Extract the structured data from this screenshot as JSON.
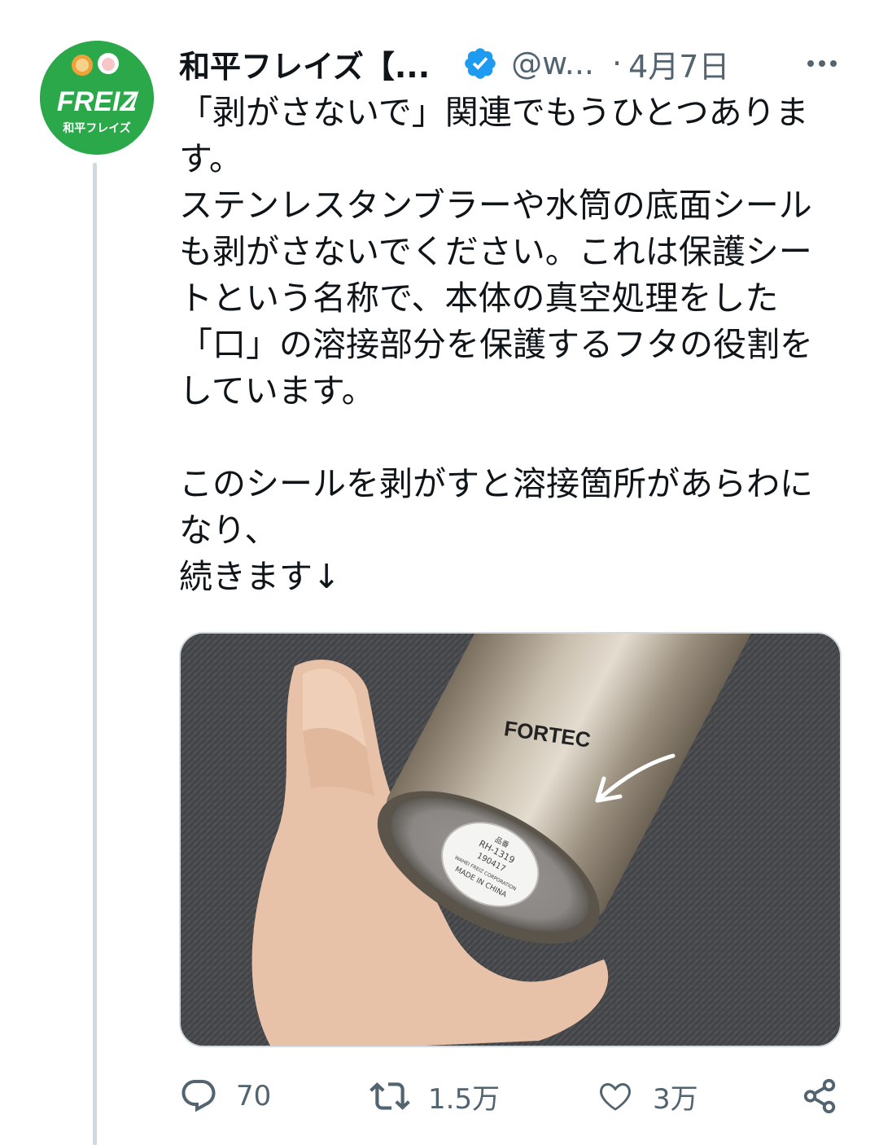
{
  "author": {
    "display_name": "和平フレイズ【...",
    "handle": "@w...",
    "separator": "·",
    "date": "4月7日",
    "avatar_text": "FREIZ",
    "avatar_subtext": "和平フレイズ"
  },
  "tweet": {
    "lines": [
      "「剥がさないで」関連でもうひとつありま",
      "す。",
      "ステンレスタンブラーや水筒の底面シール",
      "も剥がさないでください。これは保護シー",
      "トという名称で、本体の真空処理をした",
      "「口」の溶接部分を保護するフタの役割を",
      "しています。",
      "",
      "このシールを剥がすと溶接箇所があらわに",
      "なり、",
      "続きます↓"
    ]
  },
  "media": {
    "brand_text": "FORTEC",
    "label_lines": [
      "品番",
      "RH-1319",
      "190417",
      "WAHEI FREIZ CORPORATION",
      "MADE IN CHINA"
    ]
  },
  "actions": {
    "reply_count": "70",
    "retweet_count": "1.5万",
    "like_count": "3万"
  },
  "colors": {
    "avatar_green": "#2aa84a",
    "verified_blue": "#1d9bf0",
    "muted_text": "#536471"
  },
  "icons": [
    "verified-icon",
    "more-icon",
    "reply-icon",
    "retweet-icon",
    "like-icon",
    "share-icon"
  ]
}
